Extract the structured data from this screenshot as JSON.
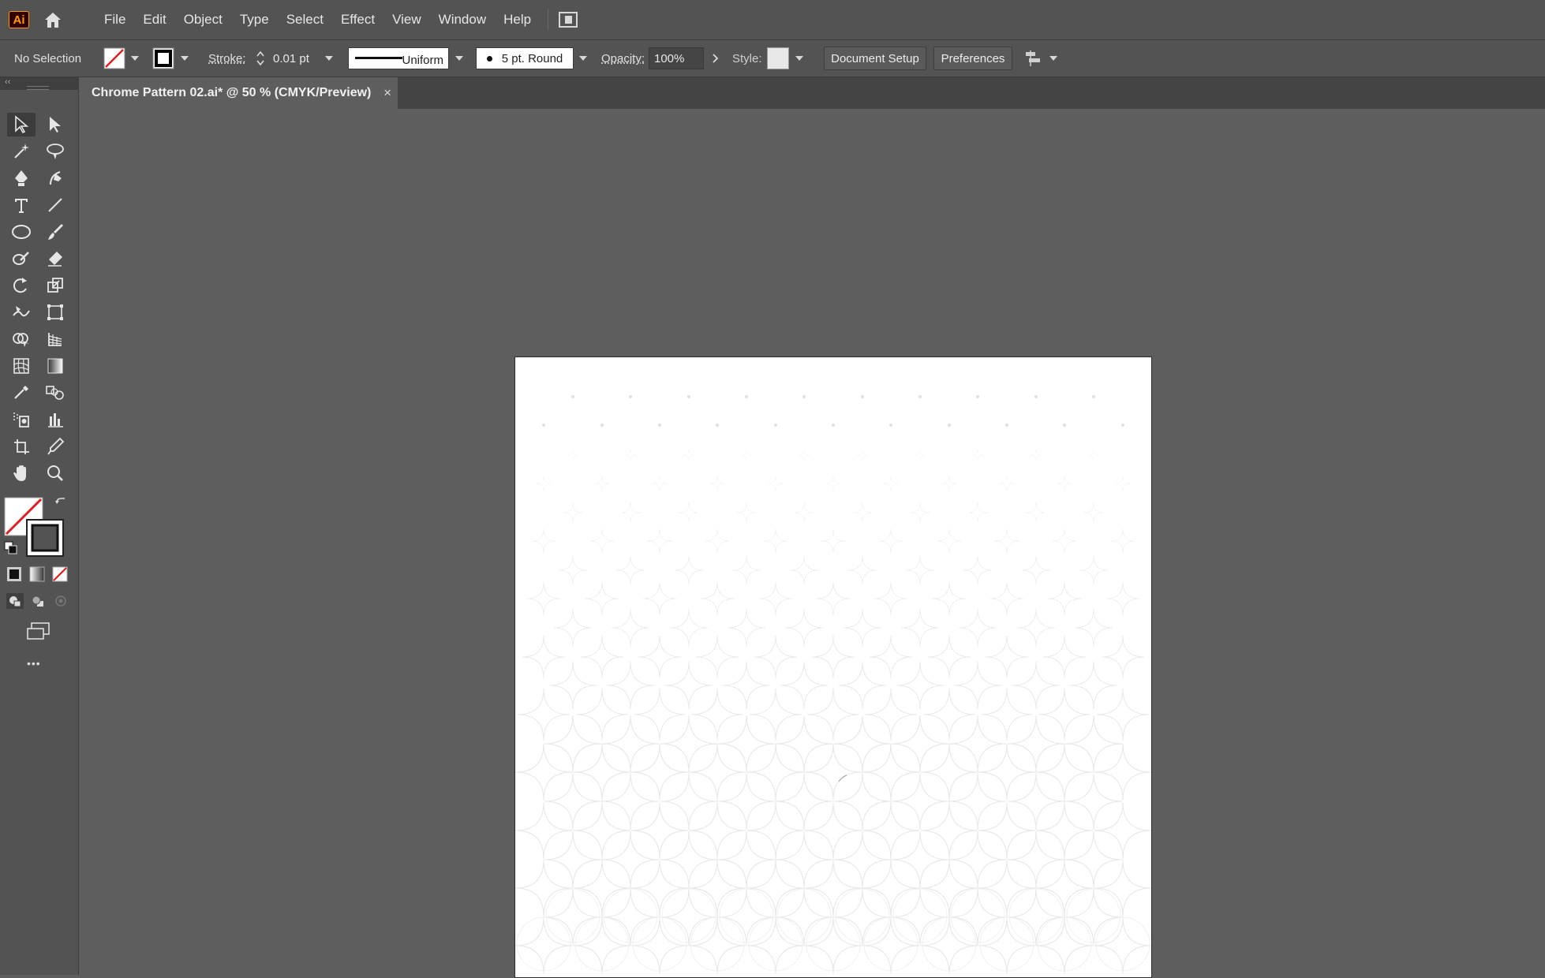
{
  "app": {
    "logo_text": "Ai",
    "accent": "#ff9a00"
  },
  "menu": {
    "items": [
      "File",
      "Edit",
      "Object",
      "Type",
      "Select",
      "Effect",
      "View",
      "Window",
      "Help"
    ]
  },
  "control": {
    "selection": "No Selection",
    "stroke_label": "Stroke:",
    "stroke_value": "0.01 pt",
    "profile": "Uniform",
    "brush": "5 pt. Round",
    "opacity_label": "Opacity:",
    "opacity_value": "100%",
    "style_label": "Style:",
    "document_setup": "Document Setup",
    "preferences": "Preferences"
  },
  "document": {
    "tab_title": "Chrome Pattern 02.ai* @ 50 % (CMYK/Preview)",
    "close": "×"
  },
  "toolbar": {
    "more": "•••"
  }
}
